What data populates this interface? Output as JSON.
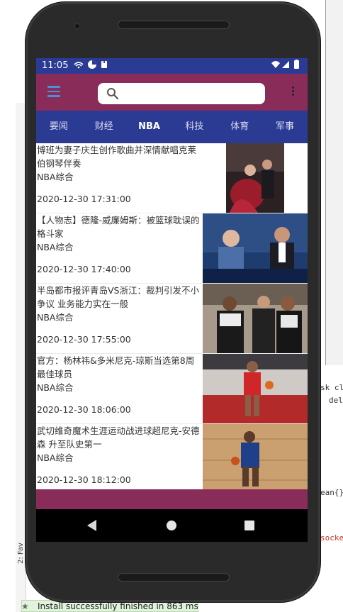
{
  "status_bar": {
    "time": "11:05"
  },
  "search": {
    "placeholder": ""
  },
  "tabs": [
    {
      "label": "要闻"
    },
    {
      "label": "财经"
    },
    {
      "label": "NBA"
    },
    {
      "label": "科技"
    },
    {
      "label": "体育"
    },
    {
      "label": "军事"
    }
  ],
  "active_tab": "NBA",
  "news": [
    {
      "title": "博班为妻子庆生创作歌曲并深情献唱克莱伯钢琴伴奏",
      "source": "NBA综合",
      "date": "2020-12-30 17:31:00"
    },
    {
      "title": "【人物志】德隆-威廉姆斯：被篮球耽误的格斗家",
      "source": "NBA综合",
      "date": "2020-12-30 17:40:00"
    },
    {
      "title": "半岛都市报评青岛VS浙江：裁判引发不小争议 业务能力实在一般",
      "source": "NBA综合",
      "date": "2020-12-30 17:55:00"
    },
    {
      "title": "官方：杨林祎&多米尼克-琼斯当选第8周最佳球员",
      "source": "NBA综合",
      "date": "2020-12-30 18:06:00"
    },
    {
      "title": "武切维奇魔术生涯运动战进球超尼克-安德森 升至队史第一",
      "source": "NBA综合",
      "date": "2020-12-30 18:12:00"
    }
  ],
  "ide": {
    "code_line_1": "sk cl",
    "code_line_2": "del",
    "code_line_3": "ean{}",
    "code_line_4": "socke",
    "side_label": "2: Fav",
    "toast": "Install successfully finished in 863 ms."
  },
  "colors": {
    "primary": "#2b3a93",
    "accent": "#8a2c5a",
    "menu_icon": "#4a8fd8"
  }
}
